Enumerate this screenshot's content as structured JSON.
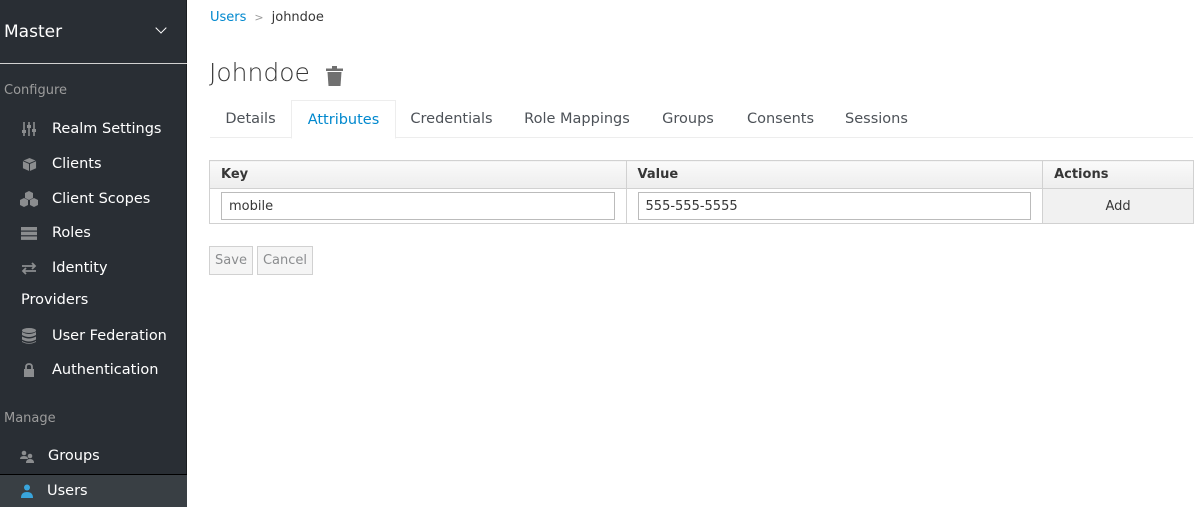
{
  "sidebar": {
    "realm": "Master",
    "configure_label": "Configure",
    "manage_label": "Manage",
    "configure_items": [
      {
        "label": "Realm Settings",
        "icon": "sliders-icon"
      },
      {
        "label": "Clients",
        "icon": "cube-icon"
      },
      {
        "label": "Client Scopes",
        "icon": "cubes-icon"
      },
      {
        "label": "Roles",
        "icon": "server-icon"
      },
      {
        "label": "Identity",
        "icon": "exchange-icon"
      },
      {
        "label": "User Federation",
        "icon": "database-icon"
      },
      {
        "label": "Authentication",
        "icon": "lock-icon"
      }
    ],
    "identity_line2": "Providers",
    "manage_items": [
      {
        "label": "Groups",
        "icon": "users-icon"
      },
      {
        "label": "Users",
        "icon": "user-icon",
        "active": true
      }
    ]
  },
  "breadcrumb": {
    "parent": "Users",
    "current": "johndoe"
  },
  "title": "Johndoe",
  "tabs": [
    "Details",
    "Attributes",
    "Credentials",
    "Role Mappings",
    "Groups",
    "Consents",
    "Sessions"
  ],
  "active_tab": "Attributes",
  "table": {
    "headers": [
      "Key",
      "Value",
      "Actions"
    ],
    "row": {
      "key": "mobile",
      "value": "555-555-5555",
      "action": "Add"
    }
  },
  "buttons": {
    "save": "Save",
    "cancel": "Cancel"
  },
  "colors": {
    "accent": "#0088ce",
    "sidebar_bg": "#292e34"
  }
}
